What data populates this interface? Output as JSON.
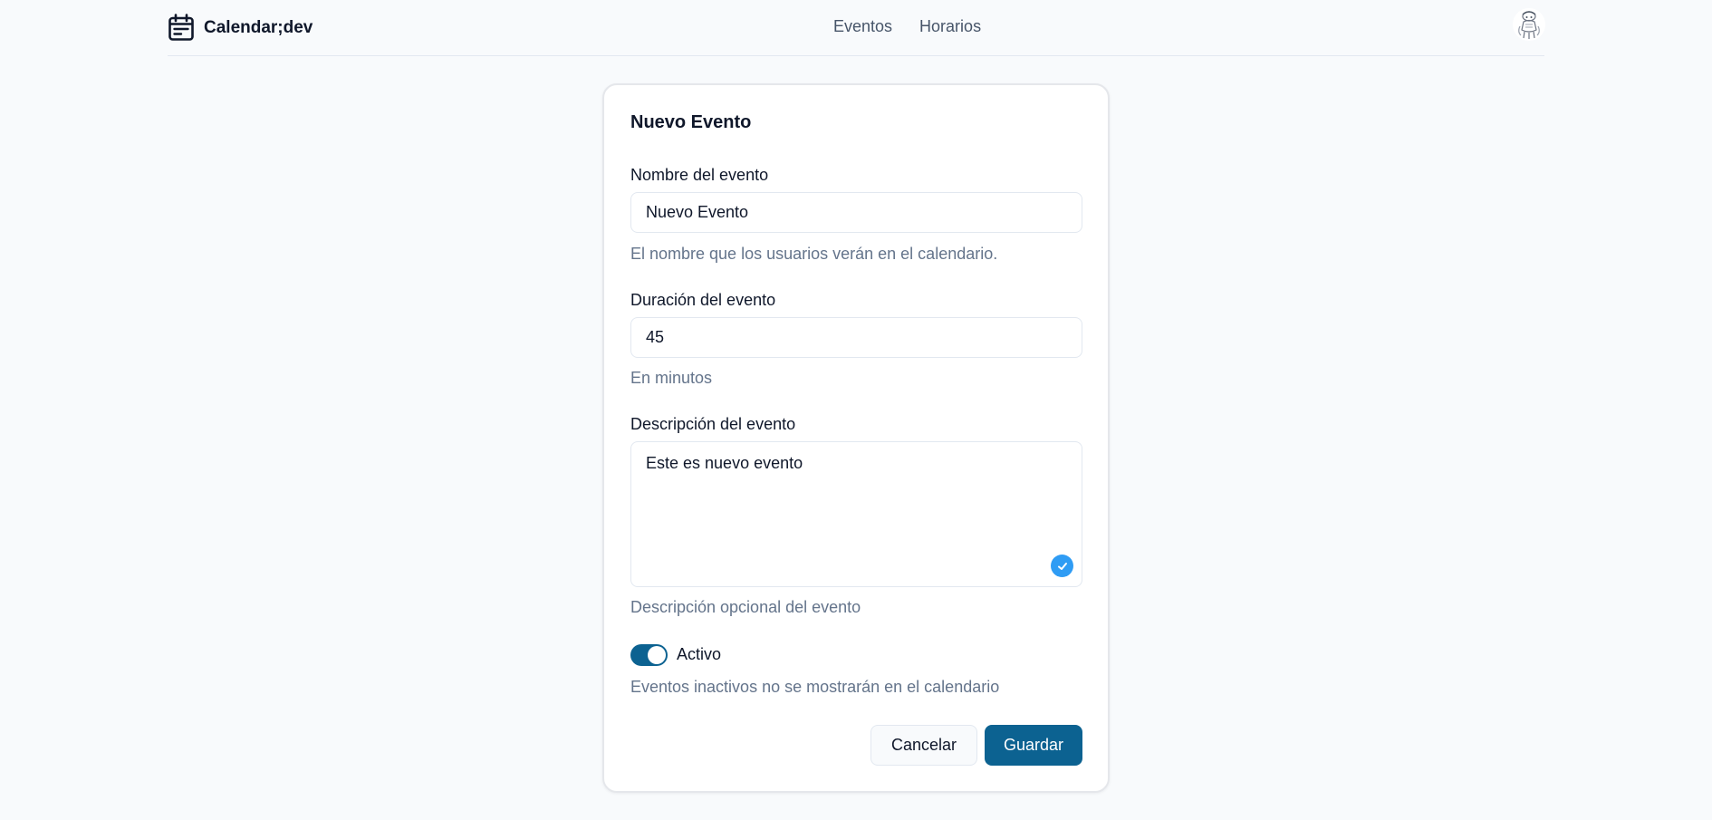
{
  "header": {
    "brand_name": "Calendar;dev",
    "brand_icon": "calendar-icon",
    "nav": [
      {
        "label": "Eventos"
      },
      {
        "label": "Horarios"
      }
    ],
    "avatar_icon": "user-avatar-icon"
  },
  "form": {
    "title": "Nuevo Evento",
    "name": {
      "label": "Nombre del evento",
      "value": "Nuevo Evento",
      "help": "El nombre que los usuarios verán en el calendario."
    },
    "duration": {
      "label": "Duración del evento",
      "value": "45",
      "help": "En minutos"
    },
    "description": {
      "label": "Descripción del evento",
      "value": "Este es nuevo evento",
      "help": "Descripción opcional del evento",
      "validation_icon": "check-circle-icon"
    },
    "active": {
      "label": "Activo",
      "checked": true,
      "help": "Eventos inactivos no se mostrarán en el calendario"
    },
    "cancel_label": "Cancelar",
    "save_label": "Guardar"
  },
  "colors": {
    "primary": "#0c6291",
    "validation": "#2f9cf4",
    "muted_text": "#64748b",
    "background": "#f8fafc"
  }
}
